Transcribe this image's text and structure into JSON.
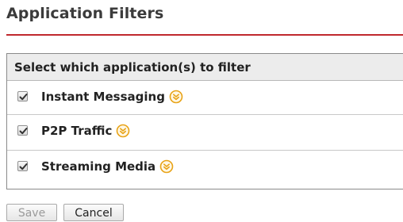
{
  "page": {
    "title": "Application Filters"
  },
  "panel": {
    "header": "Select which application(s) to filter",
    "items": [
      {
        "label": "Instant Messaging",
        "checked": true
      },
      {
        "label": "P2P Traffic",
        "checked": true
      },
      {
        "label": "Streaming Media",
        "checked": true
      }
    ]
  },
  "buttons": {
    "save_label": "Save",
    "cancel_label": "Cancel",
    "save_enabled": false
  },
  "colors": {
    "accent_rule": "#c0282d",
    "expand_icon": "#e8a317"
  }
}
